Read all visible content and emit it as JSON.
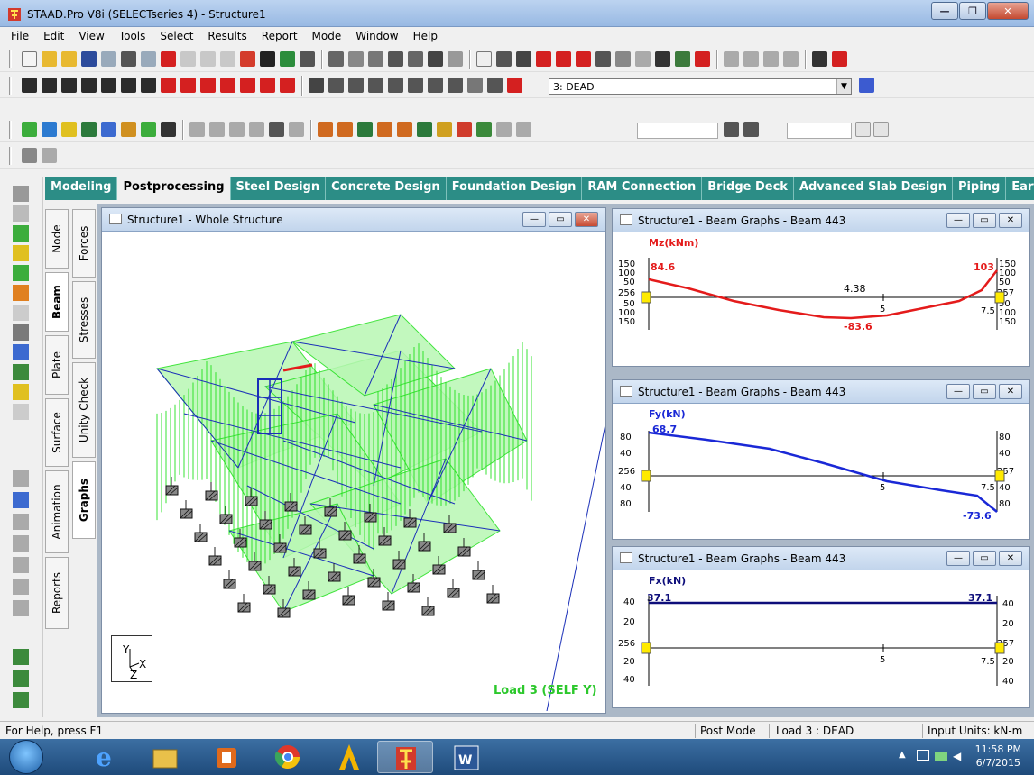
{
  "app": {
    "title": "STAAD.Pro V8i (SELECTseries 4) - Structure1"
  },
  "menu": [
    "File",
    "Edit",
    "View",
    "Tools",
    "Select",
    "Results",
    "Report",
    "Mode",
    "Window",
    "Help"
  ],
  "toolbar": {
    "load_case_value": "3: DEAD"
  },
  "page_tabs": [
    {
      "label": "Modeling",
      "active": false
    },
    {
      "label": "Postprocessing",
      "active": true
    },
    {
      "label": "Steel Design",
      "active": false
    },
    {
      "label": "Concrete Design",
      "active": false
    },
    {
      "label": "Foundation Design",
      "active": false
    },
    {
      "label": "RAM Connection",
      "active": false
    },
    {
      "label": "Bridge Deck",
      "active": false
    },
    {
      "label": "Advanced Slab Design",
      "active": false
    },
    {
      "label": "Piping",
      "active": false
    },
    {
      "label": "Earthq",
      "active": false
    }
  ],
  "vtabs_col1": [
    "Node",
    "Beam",
    "Plate",
    "Surface",
    "Animation",
    "Reports"
  ],
  "vtabs_col2": [
    "Forces",
    "Stresses",
    "Unity Check",
    "Graphs"
  ],
  "structure_window": {
    "title": "Structure1 - Whole Structure",
    "load_label": "Load 3 (SELF Y)",
    "axis_y": "Y",
    "axis_x": "X",
    "axis_z": "Z"
  },
  "graphs": [
    {
      "title": "Structure1 - Beam Graphs - Beam 443",
      "quantity": "Mz(kNm)",
      "color": "#e41b1b",
      "left_node": "256",
      "right_node": "257",
      "start_value": "84.6",
      "end_value": "103",
      "mid_value_top": "4.38",
      "min_value": "-83.6",
      "mid_tick": "5",
      "end_tick": "7.5",
      "left_ticks": [
        "150",
        "100",
        "50",
        "50",
        "100",
        "150"
      ],
      "right_ticks": [
        "150",
        "100",
        "50",
        "50",
        "100",
        "150"
      ]
    },
    {
      "title": "Structure1 - Beam Graphs - Beam 443",
      "quantity": "Fy(kN)",
      "color": "#1a28d6",
      "left_node": "256",
      "right_node": "257",
      "start_value": "68.7",
      "end_value": "-73.6",
      "mid_tick": "5",
      "end_tick": "7.5",
      "left_ticks": [
        "80",
        "40",
        "40",
        "80"
      ],
      "right_ticks": [
        "80",
        "40",
        "40",
        "80"
      ]
    },
    {
      "title": "Structure1 - Beam Graphs - Beam 443",
      "quantity": "Fx(kN)",
      "color": "#0d0d7a",
      "left_node": "256",
      "right_node": "257",
      "start_value": "37.1",
      "end_value": "37.1",
      "mid_tick": "5",
      "end_tick": "7.5",
      "left_ticks": [
        "40",
        "20",
        "20",
        "40"
      ],
      "right_ticks": [
        "40",
        "20",
        "20",
        "40"
      ]
    }
  ],
  "statusbar": {
    "help": "For Help, press F1",
    "mode": "Post Mode",
    "load": "Load 3 : DEAD",
    "units": "Input Units:  kN-m"
  },
  "taskbar": {
    "time": "11:58 PM",
    "date": "6/7/2015"
  },
  "colors": {
    "tab_bar": "#2c8d86",
    "structure_green": "#22e01d",
    "structure_blue": "#1a2fb8"
  }
}
